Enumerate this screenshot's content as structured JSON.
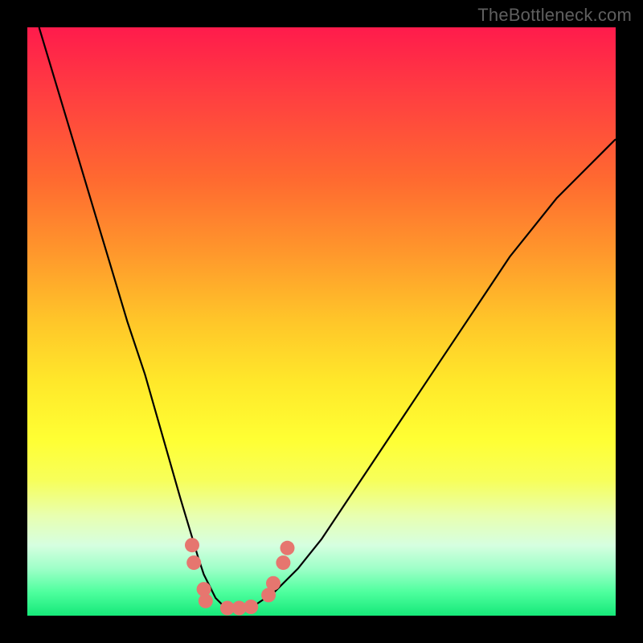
{
  "watermark": "TheBottleneck.com",
  "chart_data": {
    "type": "line",
    "title": "",
    "xlabel": "",
    "ylabel": "",
    "xlim": [
      0,
      100
    ],
    "ylim": [
      0,
      100
    ],
    "series": [
      {
        "name": "curve",
        "x": [
          2,
          5,
          8,
          11,
          14,
          17,
          20,
          22,
          24,
          26,
          27.5,
          29,
          30,
          31,
          32,
          33,
          34,
          35.5,
          37,
          39,
          42,
          46,
          50,
          54,
          58,
          62,
          66,
          70,
          74,
          78,
          82,
          86,
          90,
          94,
          98,
          100
        ],
        "values": [
          100,
          90,
          80,
          70,
          60,
          50,
          41,
          34,
          27,
          20,
          15,
          10,
          7,
          5,
          3,
          2,
          1.5,
          1.2,
          1.4,
          2,
          4,
          8,
          13,
          19,
          25,
          31,
          37,
          43,
          49,
          55,
          61,
          66,
          71,
          75,
          79,
          81
        ]
      },
      {
        "name": "lumps",
        "points": [
          {
            "x": 28.0,
            "y": 12.0
          },
          {
            "x": 28.3,
            "y": 9.0
          },
          {
            "x": 30.0,
            "y": 4.5
          },
          {
            "x": 30.3,
            "y": 2.5
          },
          {
            "x": 34.0,
            "y": 1.3
          },
          {
            "x": 36.0,
            "y": 1.3
          },
          {
            "x": 38.0,
            "y": 1.5
          },
          {
            "x": 41.0,
            "y": 3.5
          },
          {
            "x": 41.8,
            "y": 5.5
          },
          {
            "x": 43.5,
            "y": 9.0
          },
          {
            "x": 44.2,
            "y": 11.5
          }
        ]
      }
    ],
    "gradient_stops": [
      {
        "pos": 0,
        "color": "#ff1b4c"
      },
      {
        "pos": 12,
        "color": "#ff4040"
      },
      {
        "pos": 26,
        "color": "#ff6a30"
      },
      {
        "pos": 38,
        "color": "#ff962c"
      },
      {
        "pos": 50,
        "color": "#ffc629"
      },
      {
        "pos": 60,
        "color": "#ffe72a"
      },
      {
        "pos": 70,
        "color": "#ffff33"
      },
      {
        "pos": 77,
        "color": "#f7ff5a"
      },
      {
        "pos": 83,
        "color": "#e8ffb0"
      },
      {
        "pos": 88,
        "color": "#d6ffe0"
      },
      {
        "pos": 92,
        "color": "#9effc8"
      },
      {
        "pos": 96,
        "color": "#4eff9e"
      },
      {
        "pos": 100,
        "color": "#16e879"
      }
    ],
    "colors": {
      "curve": "#000000",
      "lumps": "#e6766f",
      "frame": "#000000"
    }
  }
}
